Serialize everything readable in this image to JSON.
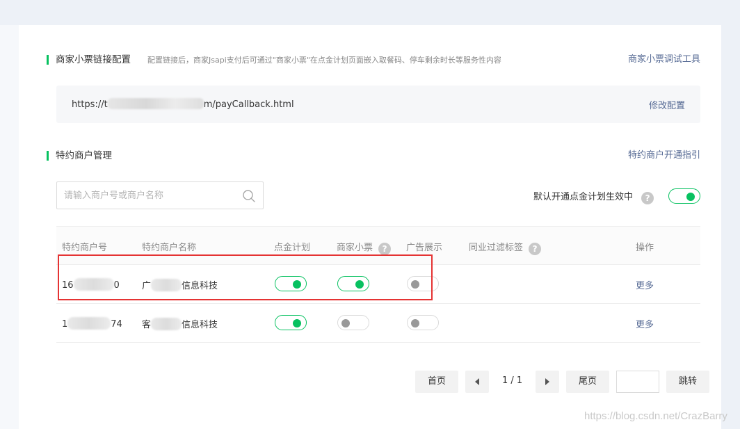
{
  "ticket_config": {
    "title": "商家小票链接配置",
    "description": "配置链接后，商家Jsapi支付后可通过\"商家小票\"在点金计划页面嵌入取餐码、停车剩余时长等服务性内容",
    "debug_tool_link": "商家小票调试工具",
    "url_prefix": "https://t",
    "url_suffix": "m/payCallback.html",
    "edit_label": "修改配置"
  },
  "merchant_mgmt": {
    "title": "特约商户管理",
    "guide_link": "特约商户开通指引",
    "search_placeholder": "请输入商户号或商户名称",
    "default_open_label": "默认开通点金计划生效中",
    "default_open_on": true
  },
  "table": {
    "headers": {
      "merchant_id": "特约商户号",
      "merchant_name": "特约商户名称",
      "gold_plan": "点金计划",
      "ticket": "商家小票",
      "ad": "广告展示",
      "filter_tag": "同业过滤标签",
      "action": "操作"
    },
    "rows": [
      {
        "id_prefix": "16",
        "id_suffix": "0",
        "name_prefix": "广",
        "name_suffix": "信息科技",
        "gold_plan": true,
        "ticket": true,
        "ad": false,
        "action": "更多"
      },
      {
        "id_prefix": "1",
        "id_suffix": "74",
        "name_prefix": "客",
        "name_suffix": "信息科技",
        "gold_plan": true,
        "ticket": false,
        "ad": false,
        "action": "更多"
      }
    ]
  },
  "pagination": {
    "first": "首页",
    "page_info": "1 / 1",
    "last": "尾页",
    "jump": "跳转"
  },
  "watermark": "https://blog.csdn.net/CrazBarry",
  "colors": {
    "accent": "#07c160",
    "link": "#576b95",
    "highlight": "#e53333"
  }
}
